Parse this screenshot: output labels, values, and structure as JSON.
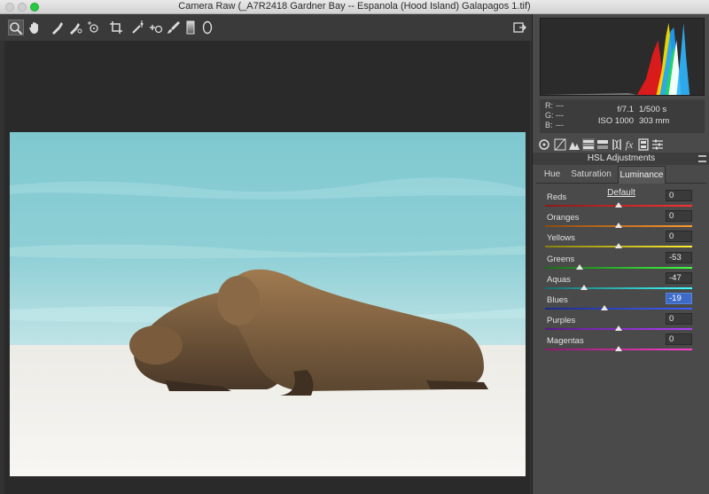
{
  "window": {
    "title": "Camera Raw (_A7R2418 Gardner Bay -- Espanola (Hood Island)  Galapagos 1.tif)"
  },
  "toolbar": {
    "tools": [
      "zoom-tool-icon",
      "hand-tool-icon",
      "white-balance-icon",
      "color-sampler-icon",
      "target-adjust-icon",
      "crop-icon",
      "straighten-icon",
      "spot-removal-icon",
      "red-eye-icon",
      "adjustment-brush-icon",
      "graduated-filter-icon",
      "radial-filter-icon"
    ],
    "export_icon": "open-preferences-icon"
  },
  "info": {
    "r_label": "R:",
    "r_value": "---",
    "g_label": "G:",
    "g_value": "---",
    "b_label": "B:",
    "b_value": "---",
    "aperture": "f/7.1",
    "shutter": "1/500 s",
    "iso": "ISO 1000",
    "focal": "303 mm"
  },
  "panel_tabs": [
    "basic-icon",
    "tone-curve-icon",
    "detail-icon",
    "hsl-icon",
    "split-toning-icon",
    "lens-corrections-icon",
    "effects-icon",
    "camera-calibration-icon",
    "presets-icon"
  ],
  "panel": {
    "title": "HSL Adjustments",
    "subtabs": [
      "Hue",
      "Saturation",
      "Luminance"
    ],
    "active_subtab": "Luminance",
    "default_label": "Default",
    "sliders": [
      {
        "label": "Reds",
        "value": "0",
        "num": 0,
        "colors": [
          "#8a1a1a",
          "#ff3030"
        ]
      },
      {
        "label": "Oranges",
        "value": "0",
        "num": 0,
        "colors": [
          "#8a4a10",
          "#ff9a30"
        ]
      },
      {
        "label": "Yellows",
        "value": "0",
        "num": 0,
        "colors": [
          "#8a8010",
          "#ffee30"
        ]
      },
      {
        "label": "Greens",
        "value": "-53",
        "num": -53,
        "colors": [
          "#1a6a1a",
          "#40ff40"
        ]
      },
      {
        "label": "Aquas",
        "value": "-47",
        "num": -47,
        "colors": [
          "#1a6a6a",
          "#40ffff"
        ]
      },
      {
        "label": "Blues",
        "value": "-19",
        "num": -19,
        "colors": [
          "#1a2a8a",
          "#4060ff"
        ],
        "selected": true
      },
      {
        "label": "Purples",
        "value": "0",
        "num": 0,
        "colors": [
          "#5a1a8a",
          "#b040ff"
        ]
      },
      {
        "label": "Magentas",
        "value": "0",
        "num": 0,
        "colors": [
          "#8a1a6a",
          "#ff40d0"
        ]
      }
    ]
  },
  "colors": {
    "panel_bg": "#4a4a4a",
    "canvas_bg": "#2a2a2a",
    "selection": "#3d6bc7"
  }
}
